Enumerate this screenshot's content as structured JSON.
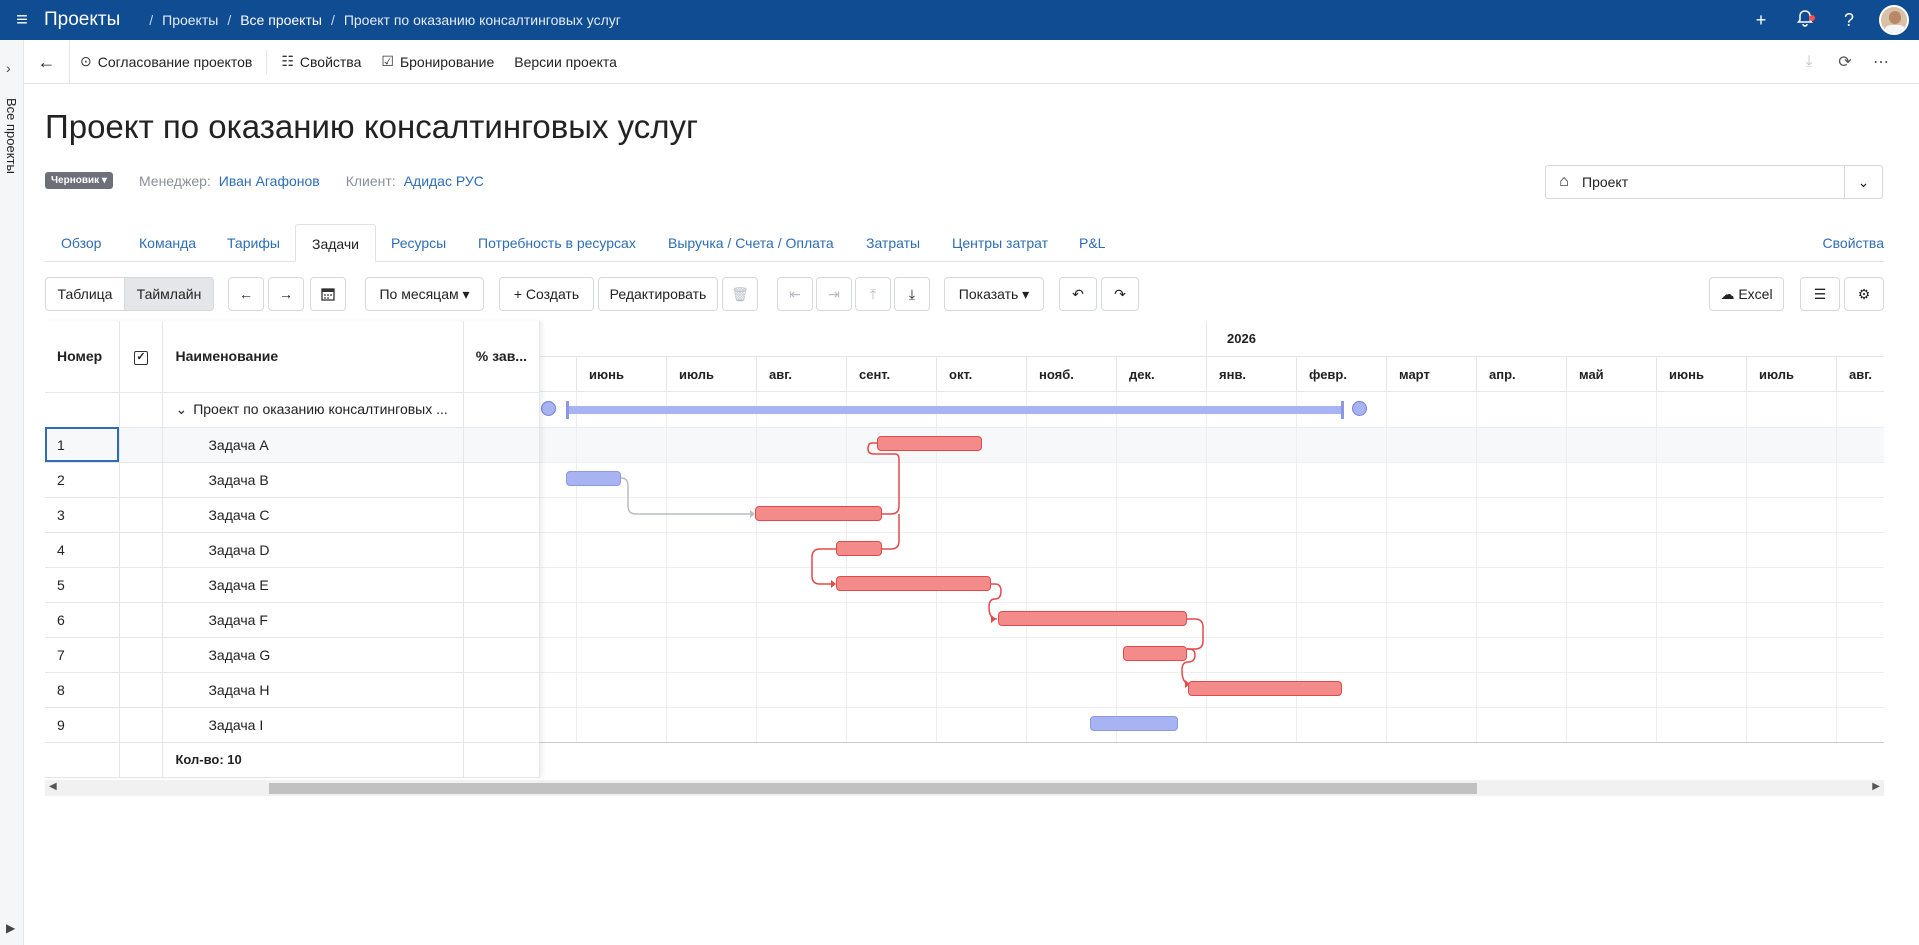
{
  "topbar": {
    "brand": "Проекты",
    "breadcrumb": [
      "Проекты",
      "Все проекты",
      "Проект по оказанию консалтинговых услуг"
    ]
  },
  "rail": {
    "label": "Все проекты"
  },
  "toolbar": {
    "approval": "Согласование проектов",
    "properties": "Свойства",
    "booking": "Бронирование",
    "versions": "Версии проекта"
  },
  "project": {
    "title": "Проект по оказанию консалтинговых услуг",
    "status": "Черновик",
    "manager_label": "Менеджер:",
    "manager": "Иван Агафонов",
    "client_label": "Клиент:",
    "client": "Адидас РУС",
    "selector": "Проект"
  },
  "tabs": [
    "Обзор",
    "Команда",
    "Тарифы",
    "Задачи",
    "Ресурсы",
    "Потребность в ресурсах",
    "Выручка / Счета / Оплата",
    "Затраты",
    "Центры затрат",
    "P&L"
  ],
  "tabs_right": "Свойства",
  "active_tab": "Задачи",
  "gantt_toolbar": {
    "table": "Таблица",
    "timeline": "Таймлайн",
    "scale": "По месяцам",
    "create": "Создать",
    "edit": "Редактировать",
    "show": "Показать",
    "excel": "Excel"
  },
  "grid": {
    "columns": [
      "Номер",
      "",
      "Наименование",
      "% зав..."
    ],
    "summary_row": "Проект по оказанию консалтинговых ...",
    "rows": [
      {
        "num": "1",
        "name": "Задача A"
      },
      {
        "num": "2",
        "name": "Задача B"
      },
      {
        "num": "3",
        "name": "Задача C"
      },
      {
        "num": "4",
        "name": "Задача D"
      },
      {
        "num": "5",
        "name": "Задача E"
      },
      {
        "num": "6",
        "name": "Задача F"
      },
      {
        "num": "7",
        "name": "Задача G"
      },
      {
        "num": "8",
        "name": "Задача H"
      },
      {
        "num": "9",
        "name": "Задача I"
      }
    ],
    "total": "Кол-во: 10"
  },
  "timeline": {
    "year": "2026",
    "months": [
      "июнь",
      "июль",
      "авг.",
      "сент.",
      "окт.",
      "нояб.",
      "дек.",
      "янв.",
      "февр.",
      "март",
      "апр.",
      "май",
      "июнь",
      "июль",
      "авг."
    ]
  }
}
